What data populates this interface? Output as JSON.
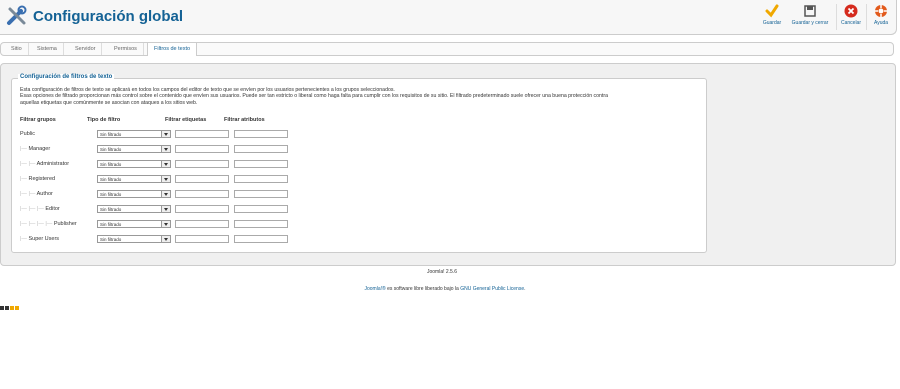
{
  "header": {
    "title": "Configuración global",
    "buttons": [
      {
        "label": "Guardar",
        "icon": "check-icon",
        "color": "#f0a800"
      },
      {
        "label": "Guardar y cerrar",
        "icon": "save-close-icon",
        "color": "#555555"
      },
      {
        "label": "Cancelar",
        "icon": "cancel-icon",
        "color": "#d52b1e"
      },
      {
        "label": "Ayuda",
        "icon": "help-icon",
        "color": "#e25a1c"
      }
    ]
  },
  "tabs": [
    {
      "label": "Sitio",
      "active": false
    },
    {
      "label": "Sistema",
      "active": false
    },
    {
      "label": "Servidor",
      "active": false
    },
    {
      "label": "Permisos",
      "active": false
    },
    {
      "label": "Filtros de texto",
      "active": true
    }
  ],
  "filters": {
    "legend": "Configuración de filtros de texto",
    "description": [
      "Esta configuración de filtros de texto se aplicará en todos los campos del editor de texto que se envíen por los usuarios pertenecientes a los grupos seleccionados.",
      "Esas opciones de filtrado proporcionan más control sobre el contenido que envíen sus usuarios. Puede ser tan estricto o liberal como haga falta para cumplir con los requisitos de su sitio. El filtrado predeterminado suele ofrecer una buena protección contra",
      "aquellas etiquetas que comúnmente se asocian con ataques a los sitios web."
    ],
    "columns": [
      "Filtrar grupos",
      "Tipo de filtro",
      "Filtrar etiquetas",
      "Filtrar atributos"
    ],
    "groups": [
      {
        "prefix": "",
        "name": "Public",
        "filter": "Sin filtrado"
      },
      {
        "prefix": "|— ",
        "name": "Manager",
        "filter": "Sin filtrado"
      },
      {
        "prefix": "|— |— ",
        "name": "Administrator",
        "filter": "Sin filtrado"
      },
      {
        "prefix": "|— ",
        "name": "Registered",
        "filter": "Sin filtrado"
      },
      {
        "prefix": "|— |— ",
        "name": "Author",
        "filter": "Sin filtrado"
      },
      {
        "prefix": "|— |— |— ",
        "name": "Editor",
        "filter": "Sin filtrado"
      },
      {
        "prefix": "|— |— |— |— ",
        "name": "Publisher",
        "filter": "Sin filtrado"
      },
      {
        "prefix": "|— ",
        "name": "Super Users",
        "filter": "Sin filtrado"
      }
    ]
  },
  "footer": {
    "version": "Joomla! 2.5.6",
    "license_brand": "Joomla!®",
    "license_text": " es software libre liberado bajo la ",
    "license_link": "GNU General Public License",
    "license_end": "."
  }
}
